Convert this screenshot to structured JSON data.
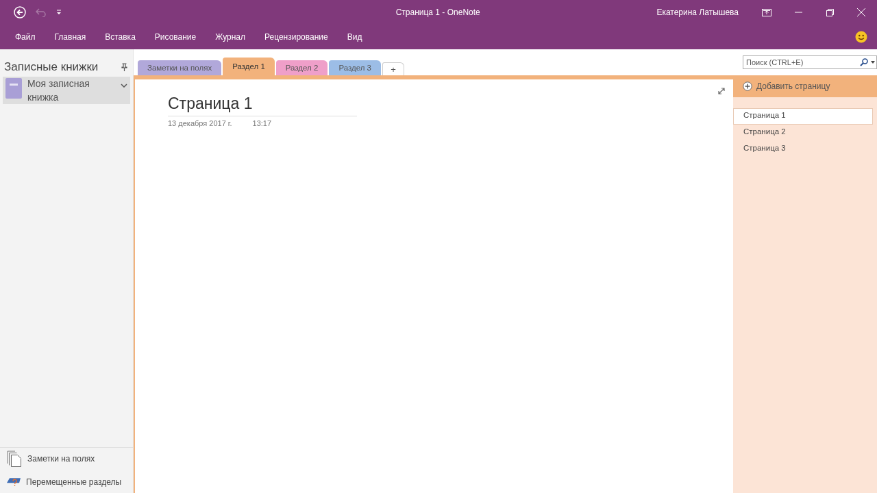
{
  "window": {
    "title": "Страница 1  -  OneNote",
    "user": "Екатерина Латышева"
  },
  "ribbon_tabs": [
    "Файл",
    "Главная",
    "Вставка",
    "Рисование",
    "Журнал",
    "Рецензирование",
    "Вид"
  ],
  "notebooks_pane": {
    "title": "Записные книжки",
    "notebooks": [
      {
        "name": "Моя записная книжка",
        "selected": true,
        "color": "#a99fd6"
      }
    ],
    "footer": [
      {
        "kind": "notes",
        "label": "Заметки на полях"
      },
      {
        "kind": "moved",
        "label": "Перемещенные разделы"
      }
    ]
  },
  "section_tabs": [
    {
      "label": "Заметки на полях",
      "color": "#b1a8da",
      "selected": false
    },
    {
      "label": "Раздел 1",
      "color": "#f2b27c",
      "selected": true
    },
    {
      "label": "Раздел 2",
      "color": "#ef9fc9",
      "selected": false
    },
    {
      "label": "Раздел 3",
      "color": "#9cbde6",
      "selected": false
    }
  ],
  "add_tab": "+",
  "search": {
    "placeholder": "Поиск (CTRL+E)"
  },
  "page": {
    "title": "Страница 1",
    "date": "13 декабря 2017 г.",
    "time": "13:17"
  },
  "page_list": {
    "add_label": "Добавить страницу",
    "pages": [
      {
        "title": "Страница 1",
        "selected": true
      },
      {
        "title": "Страница 2",
        "selected": false
      },
      {
        "title": "Страница 3",
        "selected": false
      }
    ]
  }
}
